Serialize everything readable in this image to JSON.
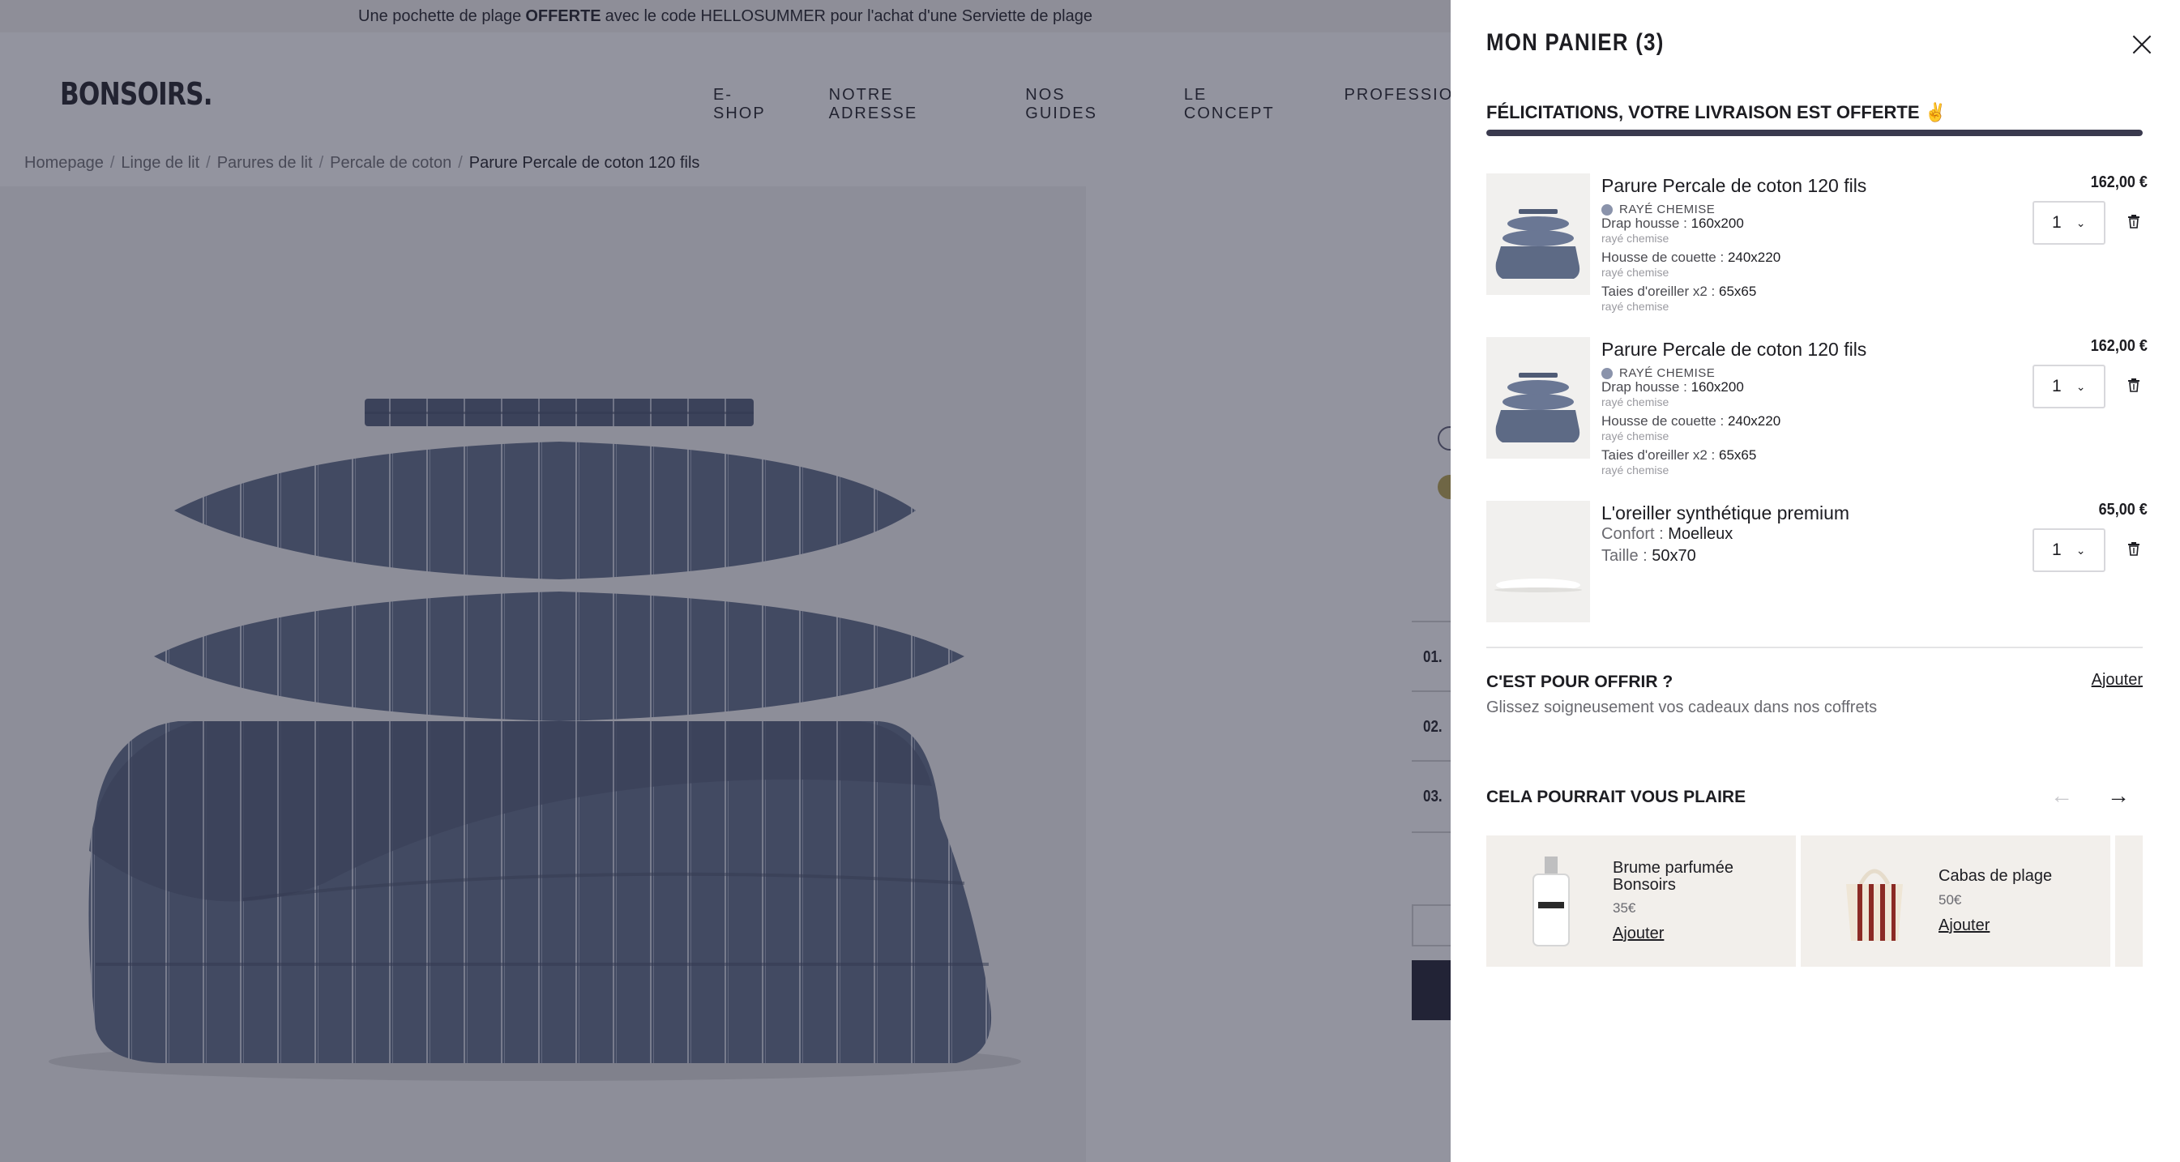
{
  "announcement": {
    "before": "Une pochette de plage",
    "bold": "OFFERTE",
    "after": "avec le code HELLOSUMMER pour l'achat d'une Serviette de plage"
  },
  "header": {
    "logo": "BONSOIRS.",
    "nav": [
      "E-SHOP",
      "NOTRE ADRESSE",
      "NOS GUIDES",
      "LE CONCEPT",
      "PROFESSIONNELS"
    ]
  },
  "breadcrumb": [
    "Homepage",
    "Linge de lit",
    "Parures de lit",
    "Percale de coton",
    "Parure Percale de coton 120 fils"
  ],
  "breadcrumb_sep": "/",
  "product_steps": [
    "01.",
    "02.",
    "03."
  ],
  "cart": {
    "title": "MON PANIER (3)",
    "shipping_message": "FÉLICITATIONS, VOTRE LIVRAISON EST OFFERTE ✌",
    "shipping_progress": 1.0,
    "items": [
      {
        "title": "Parure Percale de coton 120 fils",
        "price": "162,00 €",
        "color": "RAYÉ CHEMISE",
        "options": [
          {
            "label": "Drap housse : ",
            "value": "160x200",
            "sub": "rayé chemise"
          },
          {
            "label": "Housse de couette : ",
            "value": "240x220",
            "sub": "rayé chemise"
          },
          {
            "label": "Taies d'oreiller x2 : ",
            "value": "65x65",
            "sub": "rayé chemise"
          }
        ],
        "qty": "1"
      },
      {
        "title": "Parure Percale de coton 120 fils",
        "price": "162,00 €",
        "color": "RAYÉ CHEMISE",
        "options": [
          {
            "label": "Drap housse : ",
            "value": "160x200",
            "sub": "rayé chemise"
          },
          {
            "label": "Housse de couette : ",
            "value": "240x220",
            "sub": "rayé chemise"
          },
          {
            "label": "Taies d'oreiller x2 : ",
            "value": "65x65",
            "sub": "rayé chemise"
          }
        ],
        "qty": "1"
      },
      {
        "title": "L'oreiller synthétique premium",
        "price": "65,00 €",
        "options": [
          {
            "label": "Confort : ",
            "value": "Moelleux"
          },
          {
            "label": "Taille : ",
            "value": "50x70"
          }
        ],
        "qty": "1"
      }
    ],
    "gift": {
      "title": "C'EST POUR OFFRIR ?",
      "subtitle": "Glissez soigneusement vos cadeaux dans nos coffrets",
      "link": "Ajouter"
    },
    "reco": {
      "title": "CELA POURRAIT VOUS PLAIRE",
      "prev": "←",
      "next": "→",
      "items": [
        {
          "name": "Brume parfumée Bonsoirs",
          "price": "35€",
          "cta": "Ajouter"
        },
        {
          "name": "Cabas de plage",
          "price": "50€",
          "cta": "Ajouter"
        }
      ]
    }
  },
  "colors": {
    "accent": "#1d1d2d",
    "overlay": "#282a40",
    "stripe_blue": "#5d6a85",
    "reco_bg": "#f2efeb"
  }
}
